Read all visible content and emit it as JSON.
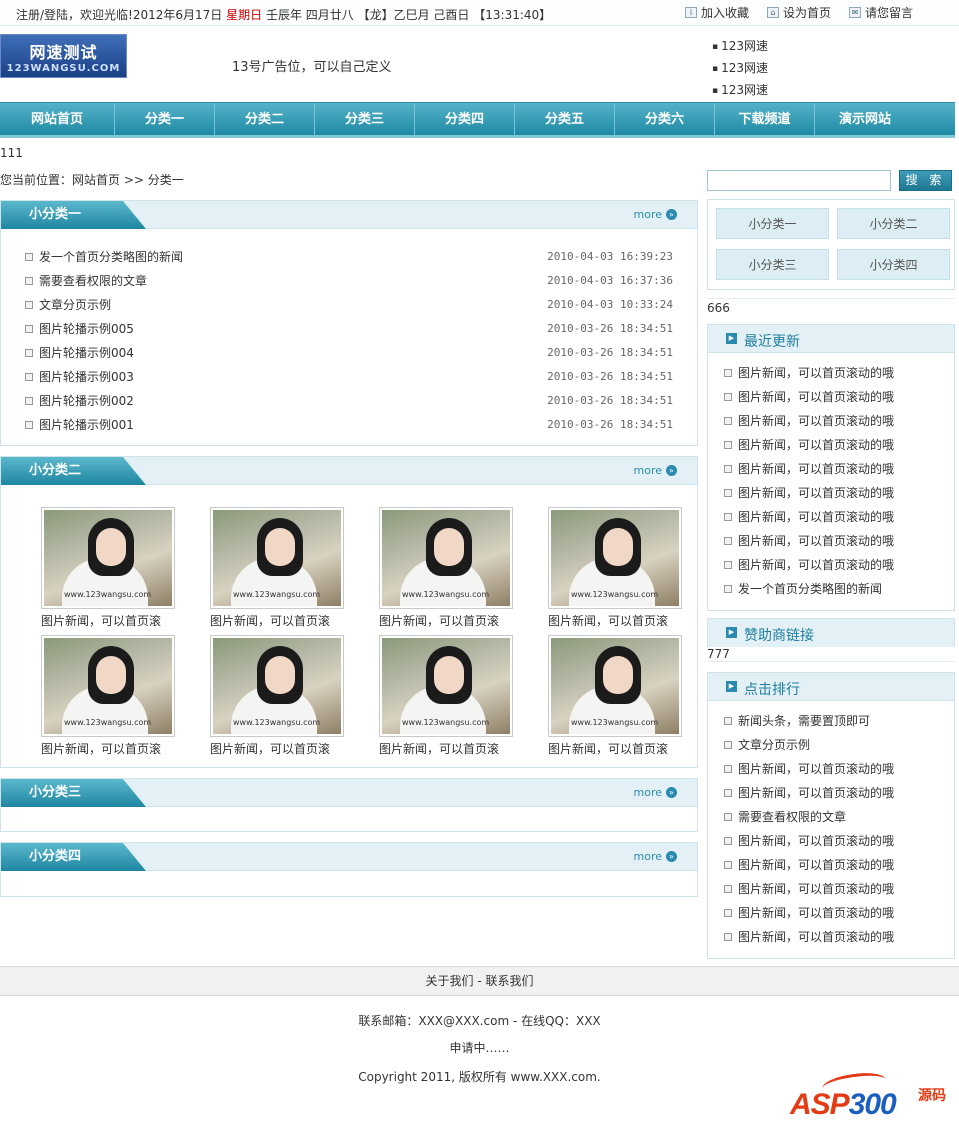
{
  "topbar": {
    "register_login": "注册/登陆",
    "welcome": "，欢迎光临!",
    "date": "2012年6月17日",
    "weekday": "星期日",
    "lunar": "壬辰年 四月廿八 【龙】乙巳月 己酉日",
    "time": "【13:31:40】",
    "add_favorite": "加入收藏",
    "set_home": "设为首页",
    "guestbook": "请您留言"
  },
  "header": {
    "logo_line1": "网速测试",
    "logo_line2": "123WANGSU.COM",
    "ad_text": "13号广告位，可以自己定义",
    "links": [
      "123网速",
      "123网速",
      "123网速"
    ]
  },
  "nav": [
    "网站首页",
    "分类一",
    "分类二",
    "分类三",
    "分类四",
    "分类五",
    "分类六",
    "下载频道",
    "演示网站"
  ],
  "misc_text": "111",
  "breadcrumb": "您当前位置：网站首页 >> 分类一",
  "more_label": "more",
  "section1": {
    "title": "小分类一",
    "items": [
      {
        "title": "发一个首页分类略图的新闻",
        "date": "2010-04-03 16:39:23"
      },
      {
        "title": "需要查看权限的文章",
        "date": "2010-04-03 16:37:36"
      },
      {
        "title": "文章分页示例",
        "date": "2010-04-03 10:33:24"
      },
      {
        "title": "图片轮播示例005",
        "date": "2010-03-26 18:34:51"
      },
      {
        "title": "图片轮播示例004",
        "date": "2010-03-26 18:34:51"
      },
      {
        "title": "图片轮播示例003",
        "date": "2010-03-26 18:34:51"
      },
      {
        "title": "图片轮播示例002",
        "date": "2010-03-26 18:34:51"
      },
      {
        "title": "图片轮播示例001",
        "date": "2010-03-26 18:34:51"
      }
    ]
  },
  "section2": {
    "title": "小分类二",
    "watermark": "www.123wangsu.com",
    "captions": [
      "图片新闻，可以首页滚",
      "图片新闻，可以首页滚",
      "图片新闻，可以首页滚",
      "图片新闻，可以首页滚",
      "图片新闻，可以首页滚",
      "图片新闻，可以首页滚",
      "图片新闻，可以首页滚",
      "图片新闻，可以首页滚"
    ]
  },
  "section3": {
    "title": "小分类三"
  },
  "section4": {
    "title": "小分类四"
  },
  "search": {
    "button": "搜 索",
    "value": ""
  },
  "subcats": [
    "小分类一",
    "小分类二",
    "小分类三",
    "小分类四"
  ],
  "misc_666": "666",
  "recent": {
    "title": "最近更新",
    "items": [
      "图片新闻，可以首页滚动的哦",
      "图片新闻，可以首页滚动的哦",
      "图片新闻，可以首页滚动的哦",
      "图片新闻，可以首页滚动的哦",
      "图片新闻，可以首页滚动的哦",
      "图片新闻，可以首页滚动的哦",
      "图片新闻，可以首页滚动的哦",
      "图片新闻，可以首页滚动的哦",
      "图片新闻，可以首页滚动的哦",
      "发一个首页分类略图的新闻"
    ]
  },
  "sponsor": {
    "title": "赞助商链接",
    "text": "777"
  },
  "ranking": {
    "title": "点击排行",
    "items": [
      "新闻头条，需要置顶即可",
      "文章分页示例",
      "图片新闻，可以首页滚动的哦",
      "图片新闻，可以首页滚动的哦",
      "需要查看权限的文章",
      "图片新闻，可以首页滚动的哦",
      "图片新闻，可以首页滚动的哦",
      "图片新闻，可以首页滚动的哦",
      "图片新闻，可以首页滚动的哦",
      "图片新闻，可以首页滚动的哦"
    ]
  },
  "footer": {
    "links": "关于我们 - 联系我们",
    "contact": "联系邮箱：XXX@XXX.com - 在线QQ：XXX",
    "icp": "申请中……",
    "copyright": "Copyright 2011, 版权所有 www.XXX.com."
  },
  "watermark_logo": {
    "text_a": "ASP",
    "text_b": "300",
    "text_c": "源码"
  },
  "colors": {
    "accent": "#1f86a1",
    "nav_gradient_top": "#55b2c8",
    "weekday": "#cc0000",
    "panel_bg": "#e3f1f6"
  }
}
